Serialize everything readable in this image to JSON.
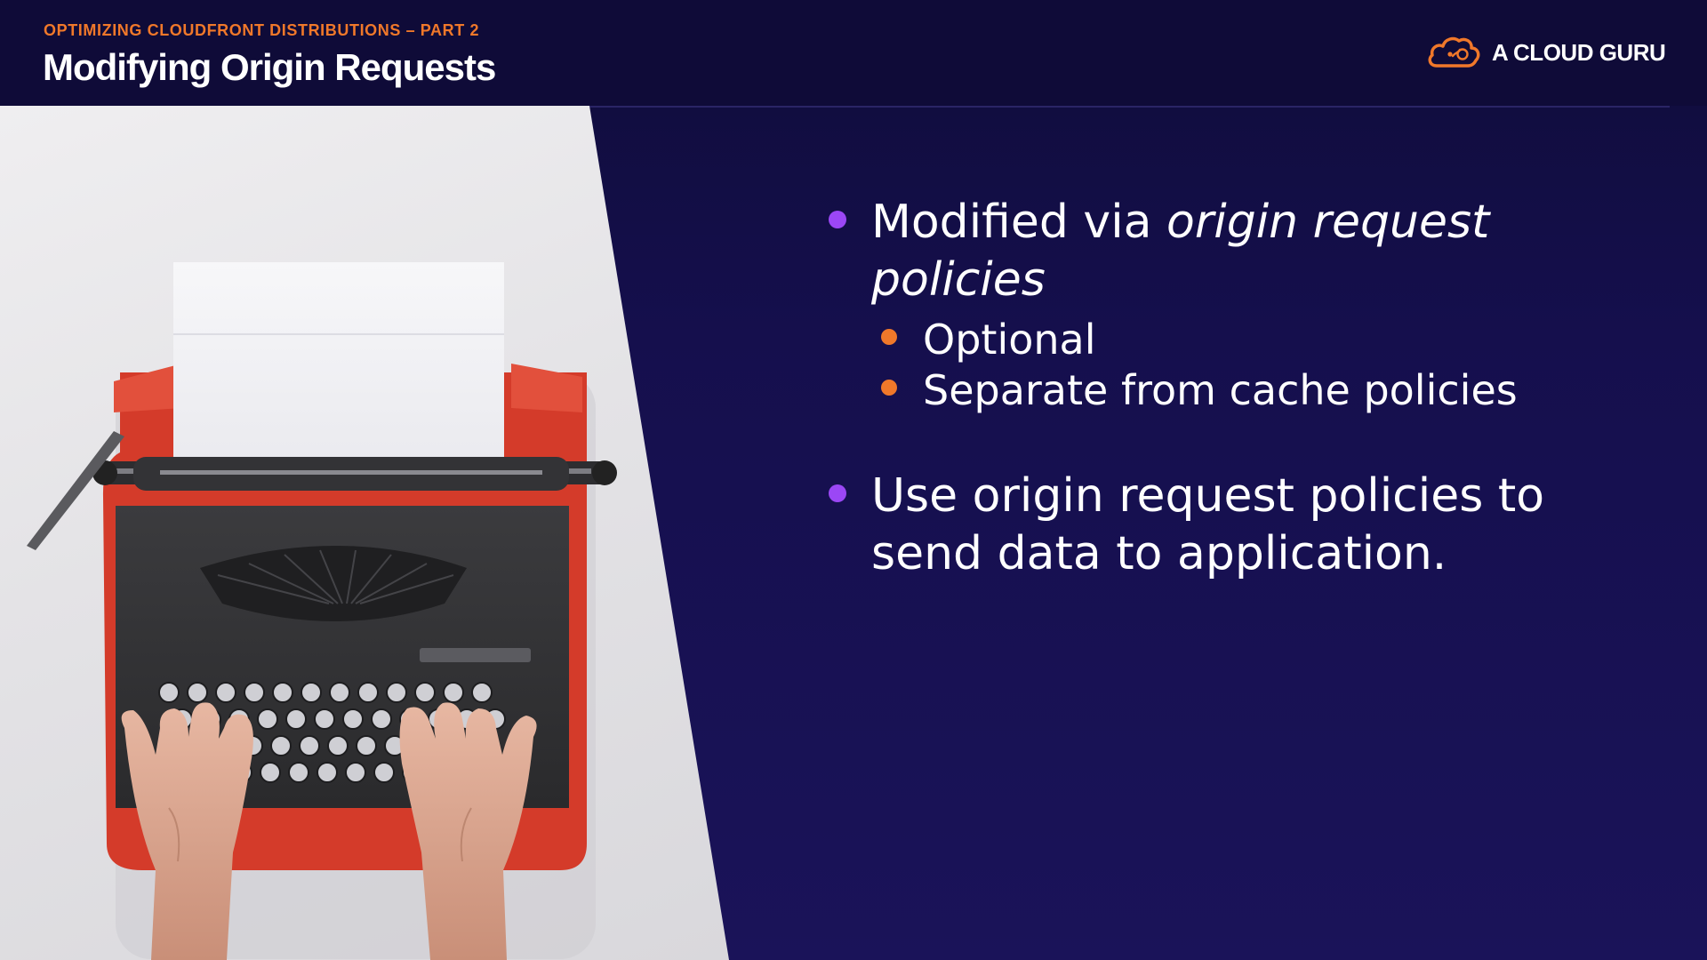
{
  "header": {
    "eyebrow": "OPTIMIZING CLOUDFRONT DISTRIBUTIONS – PART 2",
    "title": "Modifying Origin Requests",
    "brand": "A CLOUD GURU"
  },
  "photo": {
    "alt": "Hands typing on a red vintage typewriter with a blank sheet of paper"
  },
  "bullets": [
    {
      "text_plain": "Modified via ",
      "text_italic": "origin request policies",
      "sub": [
        "Optional",
        "Separate from cache policies"
      ]
    },
    {
      "text": "Use origin request policies to send data to application."
    }
  ],
  "colors": {
    "background": "#150f4d",
    "accent_orange": "#f0782a",
    "accent_purple": "#9b47f5",
    "text": "#ffffff"
  }
}
